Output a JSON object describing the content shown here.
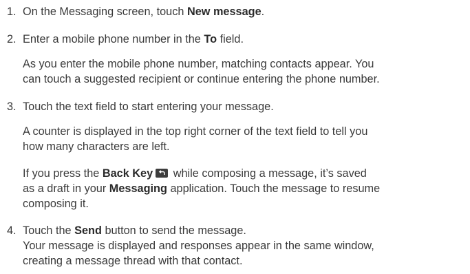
{
  "steps": [
    {
      "number": "1.",
      "pre": "On the Messaging screen, touch ",
      "bold": "New message",
      "post": "."
    },
    {
      "number": "2.",
      "pre": "Enter a mobile phone number in the ",
      "bold": "To",
      "post": " field.",
      "note_line1": "As you enter the mobile phone number, matching contacts appear. You",
      "note_line2": "can touch a suggested recipient or continue entering the phone number."
    },
    {
      "number": "3.",
      "text": "Touch the text field to start entering your message.",
      "note1_line1": "A counter is displayed in the top right corner of the text field to tell you",
      "note1_line2": "how many characters are left.",
      "note2_line1_pre": "If you press the ",
      "note2_line1_bold": "Back Key",
      "note2_line1_post": " while composing a message, it’s saved",
      "note2_line2_pre": "as a draft in your ",
      "note2_line2_bold": "Messaging",
      "note2_line2_post": " application. Touch the message to resume",
      "note2_line3": "composing it.",
      "back_key_icon": "back-key-icon"
    },
    {
      "number": "4.",
      "pre": "Touch the ",
      "bold": "Send",
      "post": " button to send the message.",
      "line2": "Your message is displayed and responses appear in the same window,",
      "line3": "creating a message thread with that contact."
    }
  ]
}
